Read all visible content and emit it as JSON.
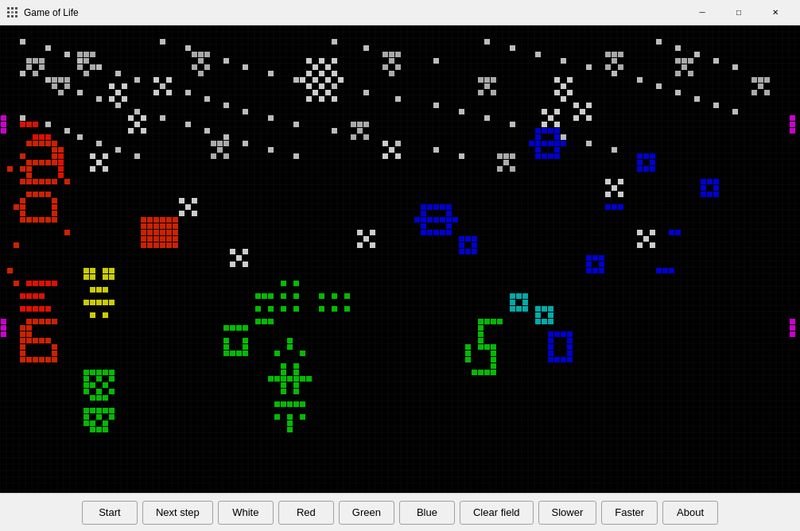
{
  "titleBar": {
    "title": "Game of Life",
    "minimizeLabel": "─",
    "maximizeLabel": "□",
    "closeLabel": "✕"
  },
  "toolbar": {
    "buttons": [
      {
        "id": "start",
        "label": "Start"
      },
      {
        "id": "next-step",
        "label": "Next step"
      },
      {
        "id": "white",
        "label": "White"
      },
      {
        "id": "red",
        "label": "Red"
      },
      {
        "id": "green",
        "label": "Green"
      },
      {
        "id": "blue",
        "label": "Blue"
      },
      {
        "id": "clear-field",
        "label": "Clear field"
      },
      {
        "id": "slower",
        "label": "Slower"
      },
      {
        "id": "faster",
        "label": "Faster"
      },
      {
        "id": "about",
        "label": "About"
      }
    ]
  },
  "game": {
    "backgroundColor": "#000000",
    "gridColor": "#1a1a1a",
    "cellSize": 10,
    "colors": {
      "white": "#ffffff",
      "red": "#cc0000",
      "green": "#00aa00",
      "blue": "#0000cc",
      "yellow": "#cccc00",
      "magenta": "#cc00cc",
      "cyan": "#00cccc"
    }
  }
}
